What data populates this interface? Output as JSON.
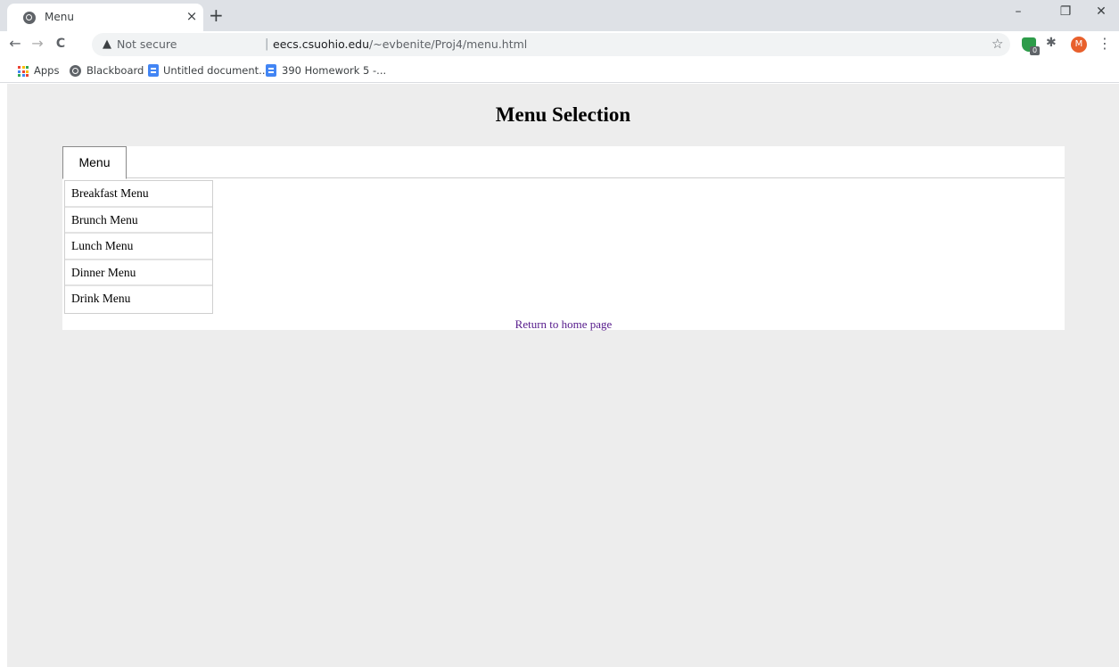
{
  "browser": {
    "tab_title": "Menu",
    "new_tab_icon": "+",
    "close_tab_icon": "×",
    "nav": {
      "back": "←",
      "forward": "→",
      "reload": "C"
    },
    "security_label": "Not secure",
    "url_domain": "eecs.csuohio.edu",
    "url_path": "/~evbenite/Proj4/menu.html",
    "extension_badge": "0",
    "avatar_letter": "M"
  },
  "bookmarks": [
    {
      "label": "Apps",
      "icon": "apps-grid-icon"
    },
    {
      "label": "Blackboard",
      "icon": "globe-icon"
    },
    {
      "label": "Untitled document...",
      "icon": "docs-icon"
    },
    {
      "label": "390 Homework 5 -...",
      "icon": "docs-icon"
    }
  ],
  "page": {
    "title": "Menu Selection",
    "tab_label": "Menu",
    "menu_items": [
      "Breakfast Menu",
      "Brunch Menu",
      "Lunch Menu",
      "Dinner Menu",
      "Drink Menu"
    ],
    "home_link": "Return to home page"
  },
  "colors": {
    "chrome": "#dee1e6",
    "page_bg": "#ededed",
    "link_visited": "#551a8b",
    "avatar": "#e8602c",
    "extension": "#2e9c4a"
  }
}
